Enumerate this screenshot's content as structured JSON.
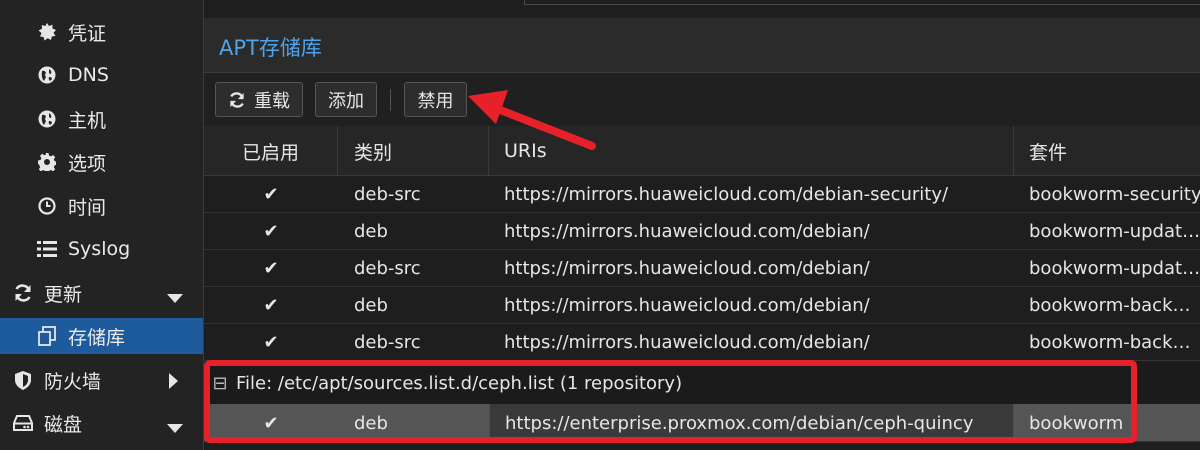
{
  "sidebar": {
    "items": [
      {
        "label": "凭证",
        "icon": "certificate-icon",
        "level": 2
      },
      {
        "label": "DNS",
        "icon": "globe-icon",
        "level": 2
      },
      {
        "label": "主机",
        "icon": "globe-icon",
        "level": 2
      },
      {
        "label": "选项",
        "icon": "gear-icon",
        "level": 2
      },
      {
        "label": "时间",
        "icon": "clock-icon",
        "level": 2
      },
      {
        "label": "Syslog",
        "icon": "list-icon",
        "level": 2
      },
      {
        "label": "更新",
        "icon": "refresh-icon",
        "level": 1,
        "caret": "down"
      },
      {
        "label": "存储库",
        "icon": "files-icon",
        "level": 2,
        "active": true
      },
      {
        "label": "防火墙",
        "icon": "shield-icon",
        "level": 1,
        "caret": "right"
      },
      {
        "label": "磁盘",
        "icon": "hdd-icon",
        "level": 1,
        "caret": "down"
      }
    ]
  },
  "panel": {
    "title": "APT存储库"
  },
  "toolbar": {
    "reload_label": "重载",
    "add_label": "添加",
    "disable_label": "禁用"
  },
  "grid": {
    "columns": [
      "已启用",
      "类别",
      "URIs",
      "套件"
    ],
    "rows": [
      {
        "enabled": "✔",
        "type": "deb-src",
        "uri": "https://mirrors.huaweicloud.com/debian-security/",
        "suite": "bookworm-security"
      },
      {
        "enabled": "✔",
        "type": "deb",
        "uri": "https://mirrors.huaweicloud.com/debian/",
        "suite": "bookworm-updat…"
      },
      {
        "enabled": "✔",
        "type": "deb-src",
        "uri": "https://mirrors.huaweicloud.com/debian/",
        "suite": "bookworm-updat…"
      },
      {
        "enabled": "✔",
        "type": "deb",
        "uri": "https://mirrors.huaweicloud.com/debian/",
        "suite": "bookworm-back…"
      },
      {
        "enabled": "✔",
        "type": "deb-src",
        "uri": "https://mirrors.huaweicloud.com/debian/",
        "suite": "bookworm-back…"
      }
    ],
    "group": {
      "toggle": "⊟",
      "label": "File: /etc/apt/sources.list.d/ceph.list (1 repository)"
    },
    "group_rows": [
      {
        "enabled": "✔",
        "type": "deb",
        "uri": "https://enterprise.proxmox.com/debian/ceph-quincy",
        "suite": "bookworm"
      }
    ]
  },
  "colors": {
    "accent": "#1d5b9c",
    "title_blue": "#4fa3ea",
    "annotation_red": "#e8202a"
  }
}
